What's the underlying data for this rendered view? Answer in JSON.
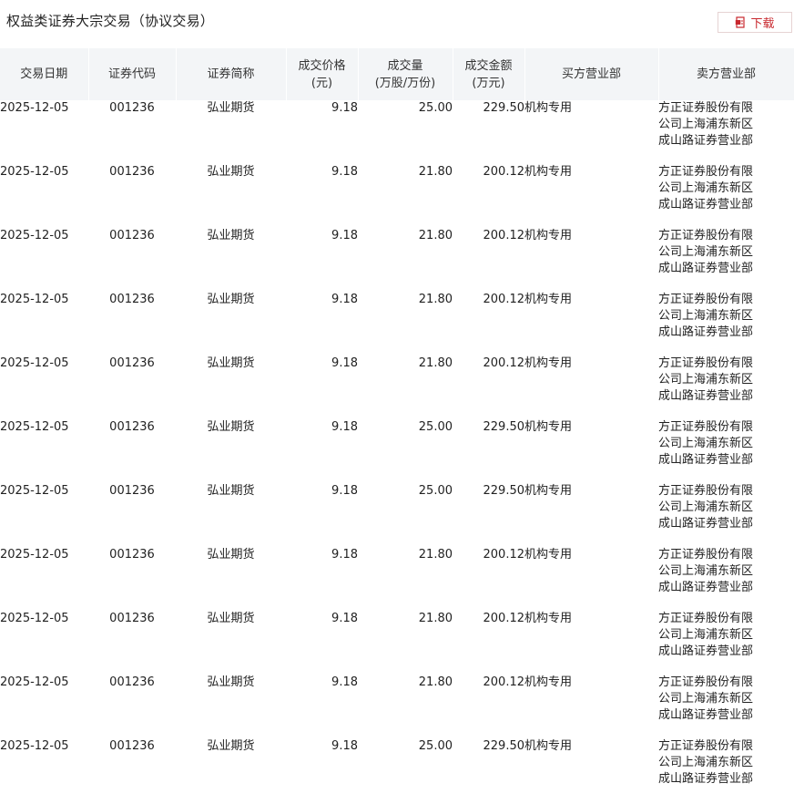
{
  "title": "权益类证券大宗交易（协议交易）",
  "download_label": "下载",
  "columns": [
    "交易日期",
    "证券代码",
    "证券简称",
    "成交价格\n(元)",
    "成交量\n(万股/万份)",
    "成交金额\n(万元)",
    "买方营业部",
    "卖方营业部"
  ],
  "rows": [
    {
      "date": "2025-12-05",
      "code": "001236",
      "name": "弘业期货",
      "price": "9.18",
      "volume": "25.00",
      "amount": "229.50",
      "buyer": "机构专用",
      "seller": "方正证券股份有限公司上海浦东新区成山路证券营业部"
    },
    {
      "date": "2025-12-05",
      "code": "001236",
      "name": "弘业期货",
      "price": "9.18",
      "volume": "21.80",
      "amount": "200.12",
      "buyer": "机构专用",
      "seller": "方正证券股份有限公司上海浦东新区成山路证券营业部"
    },
    {
      "date": "2025-12-05",
      "code": "001236",
      "name": "弘业期货",
      "price": "9.18",
      "volume": "21.80",
      "amount": "200.12",
      "buyer": "机构专用",
      "seller": "方正证券股份有限公司上海浦东新区成山路证券营业部"
    },
    {
      "date": "2025-12-05",
      "code": "001236",
      "name": "弘业期货",
      "price": "9.18",
      "volume": "21.80",
      "amount": "200.12",
      "buyer": "机构专用",
      "seller": "方正证券股份有限公司上海浦东新区成山路证券营业部"
    },
    {
      "date": "2025-12-05",
      "code": "001236",
      "name": "弘业期货",
      "price": "9.18",
      "volume": "21.80",
      "amount": "200.12",
      "buyer": "机构专用",
      "seller": "方正证券股份有限公司上海浦东新区成山路证券营业部"
    },
    {
      "date": "2025-12-05",
      "code": "001236",
      "name": "弘业期货",
      "price": "9.18",
      "volume": "25.00",
      "amount": "229.50",
      "buyer": "机构专用",
      "seller": "方正证券股份有限公司上海浦东新区成山路证券营业部"
    },
    {
      "date": "2025-12-05",
      "code": "001236",
      "name": "弘业期货",
      "price": "9.18",
      "volume": "25.00",
      "amount": "229.50",
      "buyer": "机构专用",
      "seller": "方正证券股份有限公司上海浦东新区成山路证券营业部"
    },
    {
      "date": "2025-12-05",
      "code": "001236",
      "name": "弘业期货",
      "price": "9.18",
      "volume": "21.80",
      "amount": "200.12",
      "buyer": "机构专用",
      "seller": "方正证券股份有限公司上海浦东新区成山路证券营业部"
    },
    {
      "date": "2025-12-05",
      "code": "001236",
      "name": "弘业期货",
      "price": "9.18",
      "volume": "21.80",
      "amount": "200.12",
      "buyer": "机构专用",
      "seller": "方正证券股份有限公司上海浦东新区成山路证券营业部"
    },
    {
      "date": "2025-12-05",
      "code": "001236",
      "name": "弘业期货",
      "price": "9.18",
      "volume": "21.80",
      "amount": "200.12",
      "buyer": "机构专用",
      "seller": "方正证券股份有限公司上海浦东新区成山路证券营业部"
    },
    {
      "date": "2025-12-05",
      "code": "001236",
      "name": "弘业期货",
      "price": "9.18",
      "volume": "25.00",
      "amount": "229.50",
      "buyer": "机构专用",
      "seller": "方正证券股份有限公司上海浦东新区成山路证券营业部"
    }
  ],
  "colors": {
    "accent": "#c8272d",
    "header_bg": "#f3f5f7"
  },
  "icons": {
    "download": "document-icon"
  }
}
